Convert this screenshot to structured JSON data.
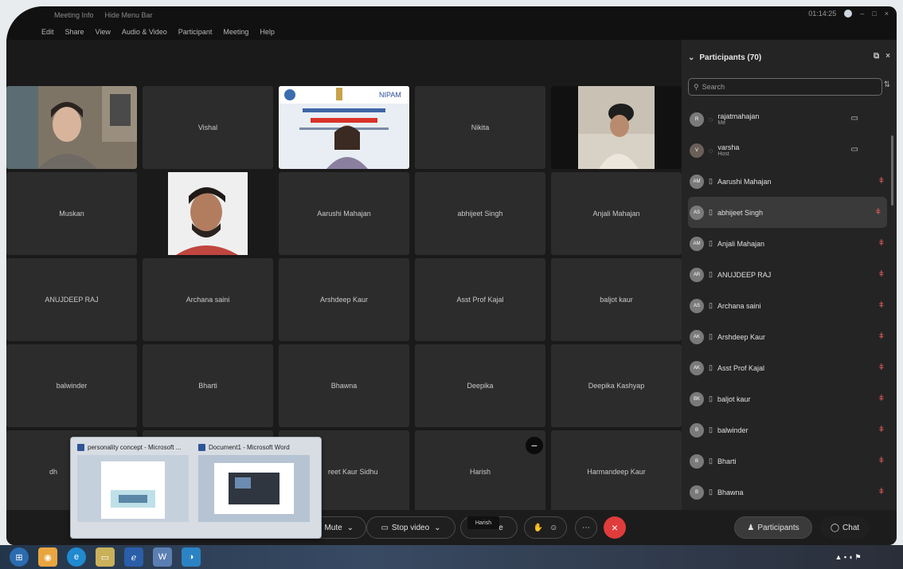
{
  "window": {
    "title_items": [
      "Meeting Info",
      "Hide Menu Bar"
    ],
    "time": "01:14:25",
    "menu": [
      "Edit",
      "Share",
      "View",
      "Audio & Video",
      "Participant",
      "Meeting",
      "Help"
    ]
  },
  "tiles": [
    {
      "label": "",
      "kind": "video"
    },
    {
      "label": "Vishal",
      "kind": "name"
    },
    {
      "label": "",
      "kind": "slide"
    },
    {
      "label": "Nikita",
      "kind": "name"
    },
    {
      "label": "",
      "kind": "video"
    },
    {
      "label": "Muskan",
      "kind": "name"
    },
    {
      "label": "",
      "kind": "video"
    },
    {
      "label": "Aarushi Mahajan",
      "kind": "name"
    },
    {
      "label": "abhijeet Singh",
      "kind": "name"
    },
    {
      "label": "Anjali Mahajan",
      "kind": "name"
    },
    {
      "label": "ANUJDEEP RAJ",
      "kind": "name"
    },
    {
      "label": "Archana saini",
      "kind": "name"
    },
    {
      "label": "Arshdeep Kaur",
      "kind": "name"
    },
    {
      "label": "Asst Prof Kajal",
      "kind": "name"
    },
    {
      "label": "baljot kaur",
      "kind": "name"
    },
    {
      "label": "balwinder",
      "kind": "name"
    },
    {
      "label": "Bharti",
      "kind": "name"
    },
    {
      "label": "Bhawna",
      "kind": "name"
    },
    {
      "label": "Deepika",
      "kind": "name"
    },
    {
      "label": "Deepika Kashyap",
      "kind": "name"
    },
    {
      "label": "dh",
      "kind": "name"
    },
    {
      "label": "",
      "kind": "name"
    },
    {
      "label": "reet Kaur Sidhu",
      "kind": "name"
    },
    {
      "label": "Harish",
      "kind": "name"
    },
    {
      "label": "Harmandeep Kaur",
      "kind": "name"
    }
  ],
  "panel": {
    "title": "Participants (70)",
    "search_placeholder": "Search",
    "participants": [
      {
        "initials": "R",
        "name": "rajatmahajan",
        "role": "Me",
        "video": true,
        "muted": false
      },
      {
        "initials": "V",
        "name": "varsha",
        "role": "Host",
        "video": true,
        "muted": false
      },
      {
        "initials": "AM",
        "name": "Aarushi Mahajan",
        "role": "",
        "video": false,
        "muted": true
      },
      {
        "initials": "AS",
        "name": "abhijeet Singh",
        "role": "",
        "video": false,
        "muted": true,
        "highlight": true
      },
      {
        "initials": "AM",
        "name": "Anjali Mahajan",
        "role": "",
        "video": false,
        "muted": true
      },
      {
        "initials": "AR",
        "name": "ANUJDEEP RAJ",
        "role": "",
        "video": false,
        "muted": true
      },
      {
        "initials": "AS",
        "name": "Archana saini",
        "role": "",
        "video": false,
        "muted": true
      },
      {
        "initials": "AK",
        "name": "Arshdeep Kaur",
        "role": "",
        "video": false,
        "muted": true
      },
      {
        "initials": "AK",
        "name": "Asst Prof Kajal",
        "role": "",
        "video": false,
        "muted": true
      },
      {
        "initials": "BK",
        "name": "baljot kaur",
        "role": "",
        "video": false,
        "muted": true
      },
      {
        "initials": "B",
        "name": "balwinder",
        "role": "",
        "video": false,
        "muted": true
      },
      {
        "initials": "B",
        "name": "Bharti",
        "role": "",
        "video": false,
        "muted": true
      },
      {
        "initials": "B",
        "name": "Bhawna",
        "role": "",
        "video": false,
        "muted": true
      }
    ]
  },
  "controls": {
    "mute_label": "Mute",
    "stop_video_label": "Stop video",
    "share_suffix": "e",
    "participants_label": "Participants",
    "chat_label": "Chat",
    "tooltip": "Harish"
  },
  "thumbnails": [
    {
      "title": "personality concept - Microsoft ..."
    },
    {
      "title": "Document1 - Microsoft Word"
    }
  ],
  "slide": {
    "banner": "NIPAM"
  }
}
